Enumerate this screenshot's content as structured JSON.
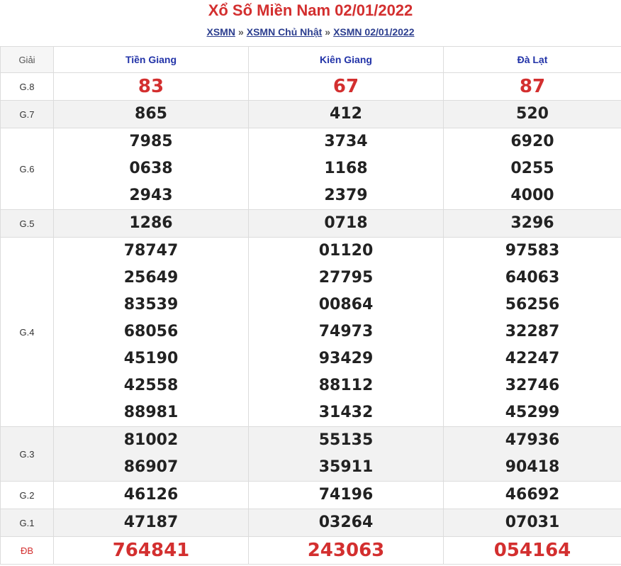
{
  "header": {
    "title": "Xổ Số Miền Nam 02/01/2022",
    "breadcrumb": [
      "XSMN",
      "XSMN Chủ Nhật",
      "XSMN 02/01/2022"
    ],
    "separator": "»"
  },
  "table": {
    "label_header": "Giải",
    "provinces": [
      "Tiền Giang",
      "Kiên Giang",
      "Đà Lạt"
    ],
    "accent_color": "#d32f2f",
    "rows": [
      {
        "label": "G.8",
        "values": [
          [
            "83"
          ],
          [
            "67"
          ],
          [
            "87"
          ]
        ]
      },
      {
        "label": "G.7",
        "values": [
          [
            "865"
          ],
          [
            "412"
          ],
          [
            "520"
          ]
        ]
      },
      {
        "label": "G.6",
        "values": [
          [
            "7985",
            "0638",
            "2943"
          ],
          [
            "3734",
            "1168",
            "2379"
          ],
          [
            "6920",
            "0255",
            "4000"
          ]
        ]
      },
      {
        "label": "G.5",
        "values": [
          [
            "1286"
          ],
          [
            "0718"
          ],
          [
            "3296"
          ]
        ]
      },
      {
        "label": "G.4",
        "values": [
          [
            "78747",
            "25649",
            "83539",
            "68056",
            "45190",
            "42558",
            "88981"
          ],
          [
            "01120",
            "27795",
            "00864",
            "74973",
            "93429",
            "88112",
            "31432"
          ],
          [
            "97583",
            "64063",
            "56256",
            "32287",
            "42247",
            "32746",
            "45299"
          ]
        ]
      },
      {
        "label": "G.3",
        "values": [
          [
            "81002",
            "86907"
          ],
          [
            "55135",
            "35911"
          ],
          [
            "47936",
            "90418"
          ]
        ]
      },
      {
        "label": "G.2",
        "values": [
          [
            "46126"
          ],
          [
            "74196"
          ],
          [
            "46692"
          ]
        ]
      },
      {
        "label": "G.1",
        "values": [
          [
            "47187"
          ],
          [
            "03264"
          ],
          [
            "07031"
          ]
        ]
      },
      {
        "label": "ĐB",
        "values": [
          [
            "764841"
          ],
          [
            "243063"
          ],
          [
            "054164"
          ]
        ]
      }
    ]
  }
}
